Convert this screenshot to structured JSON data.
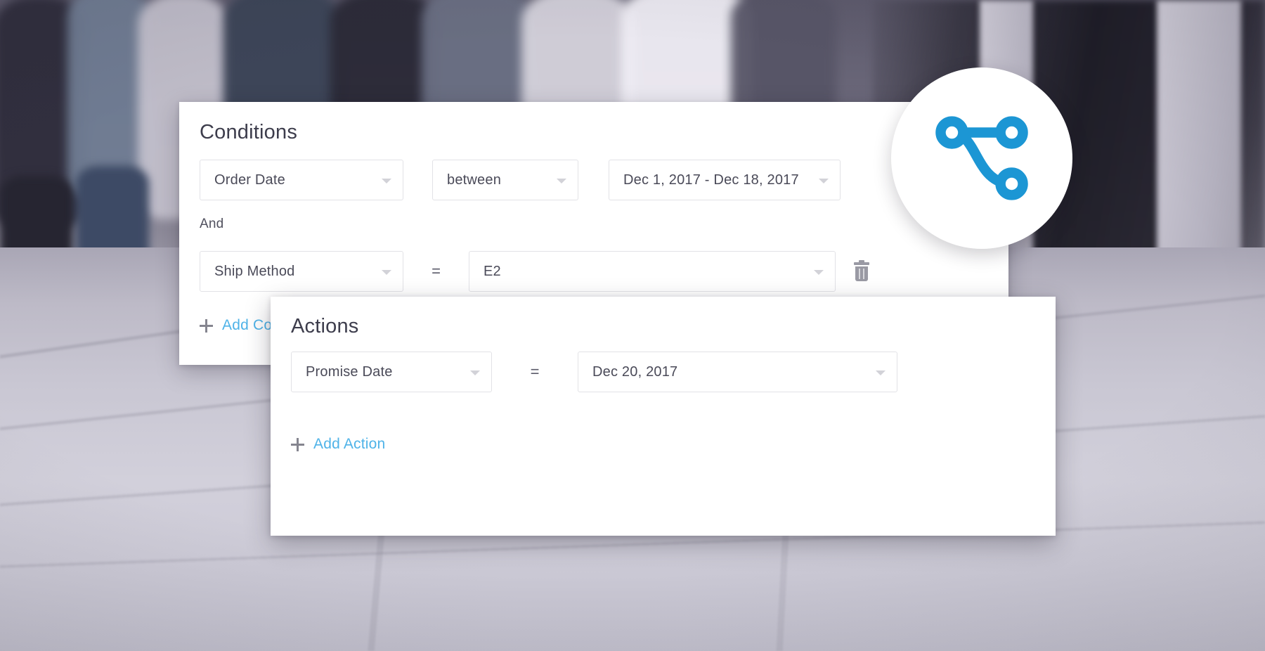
{
  "background": {
    "description": "blurred desaturated street photo of pedestrians walking on pavement"
  },
  "brand": {
    "logo_icon": "workflow-branch-icon",
    "accent_color": "#1C96D4",
    "link_color": "#4FB3E8"
  },
  "conditions_panel": {
    "title": "Conditions",
    "conjunction": "And",
    "rows": [
      {
        "attribute": "Order Date",
        "operator": "between",
        "value": "Dec 1, 2017 - Dec 18, 2017"
      },
      {
        "attribute": "Ship Method",
        "operator": "=",
        "value": "E2",
        "delete_icon": "trash-icon"
      }
    ],
    "add_link": {
      "icon": "plus-icon",
      "label": "Add Condition"
    }
  },
  "actions_panel": {
    "title": "Actions",
    "rows": [
      {
        "attribute": "Promise Date",
        "operator": "=",
        "value": "Dec 20, 2017"
      }
    ],
    "add_link": {
      "icon": "plus-icon",
      "label": "Add Action"
    }
  }
}
